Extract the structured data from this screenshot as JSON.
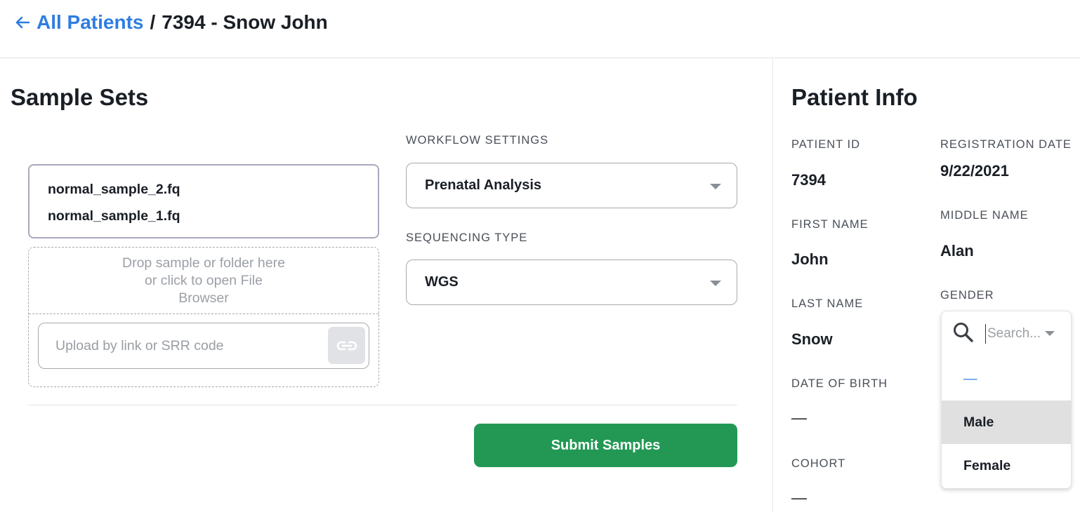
{
  "breadcrumb": {
    "back_label": "All Patients",
    "separator": "/",
    "current": "7394 - Snow John"
  },
  "sample_sets": {
    "title": "Sample Sets",
    "files": [
      "normal_sample_2.fq",
      "normal_sample_1.fq"
    ],
    "dropzone_text": "Drop sample or folder here or click to open File Browser",
    "link_placeholder": "Upload by link or SRR code",
    "link_value": "",
    "workflow_label": "WORKFLOW SETTINGS",
    "workflow_value": "Prenatal Analysis",
    "sequencing_label": "SEQUENCING TYPE",
    "sequencing_value": "WGS",
    "submit_label": "Submit Samples"
  },
  "patient_info": {
    "title": "Patient Info",
    "patient_id_label": "PATIENT ID",
    "patient_id": "7394",
    "registration_label": "REGISTRATION DATE",
    "registration_date": "9/22/2021",
    "first_name_label": "FIRST NAME",
    "first_name": "John",
    "middle_name_label": "MIDDLE NAME",
    "middle_name": "Alan",
    "last_name_label": "LAST NAME",
    "last_name": "Snow",
    "gender_label": "GENDER",
    "dob_label": "DATE OF BIRTH",
    "dob": "—",
    "cohort_label": "COHORT",
    "cohort": "—"
  },
  "gender_dropdown": {
    "search_placeholder": "Search...",
    "options": [
      "—",
      "Male",
      "Female"
    ],
    "highlighted": "Male"
  },
  "colors": {
    "link": "#2f7de1",
    "submit": "#229854",
    "highlight": "#e0e0e0"
  }
}
